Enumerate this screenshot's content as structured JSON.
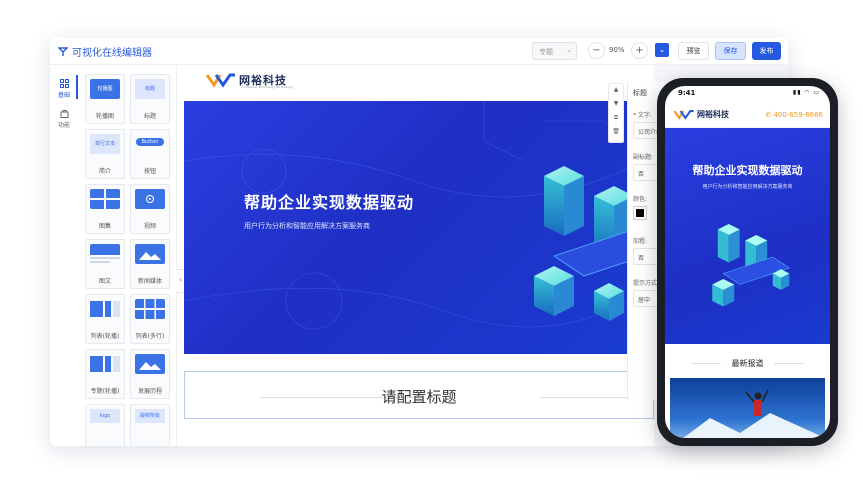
{
  "editor": {
    "app_title": "可视化在线编辑器",
    "theme_select": "专题",
    "zoom_minus": "−",
    "zoom_value": "90%",
    "zoom_plus": "+",
    "preview_label": "预览",
    "save_label": "保存",
    "publish_label": "发布"
  },
  "leftnav": {
    "items": [
      {
        "label": "基础",
        "icon": "grid-icon"
      },
      {
        "label": "功能",
        "icon": "bag-icon"
      }
    ]
  },
  "components": [
    {
      "label": "轮播图",
      "thumb": "轮播图"
    },
    {
      "label": "标题",
      "thumb": "标题"
    },
    {
      "label": "简介",
      "thumb": "单行文本"
    },
    {
      "label": "按钮",
      "thumb": "Button"
    },
    {
      "label": "图集",
      "thumb": ""
    },
    {
      "label": "视频",
      "thumb": ""
    },
    {
      "label": "图文",
      "thumb": ""
    },
    {
      "label": "新闻媒体",
      "thumb": ""
    },
    {
      "label": "列表(轮播)",
      "thumb": ""
    },
    {
      "label": "列表(多行)",
      "thumb": ""
    },
    {
      "label": "专题(轮播)",
      "thumb": ""
    },
    {
      "label": "发展历程",
      "thumb": ""
    },
    {
      "label": "",
      "thumb": "logo"
    },
    {
      "label": "",
      "thumb": "版权所有"
    }
  ],
  "site": {
    "logo_name": "网裕科技",
    "logo_sub": "Yu Internet Technology Technology",
    "banner_title": "帮助企业实现数据驱动",
    "banner_subtitle": "用户行为分析和智能应用解决方案服务商",
    "section_title": "请配置标题"
  },
  "props": {
    "header": "标题",
    "text_label": "* 文字:",
    "text_value": "公司介绍",
    "subtitle_label": "副标题:",
    "subtitle_value": "否",
    "color_label": "颜色:",
    "color_value": "#000000",
    "bold_label": "加粗:",
    "bold_value": "否",
    "align_label": "提示方式:",
    "align_value": "居中"
  },
  "toolstrip": [
    "▲",
    "▼",
    "⧉",
    "🗑"
  ],
  "mobile": {
    "time": "9:41",
    "logo_name": "网裕科技",
    "phone": "400-659-6666",
    "banner_title": "帮助企业实现数据驱动",
    "banner_subtitle": "用户行为分析和智能应用解决方案服务商",
    "news_title": "最新报道"
  },
  "colors": {
    "accent": "#2459e0",
    "banner": "#2232d2",
    "phone_text": "#f39a23"
  }
}
